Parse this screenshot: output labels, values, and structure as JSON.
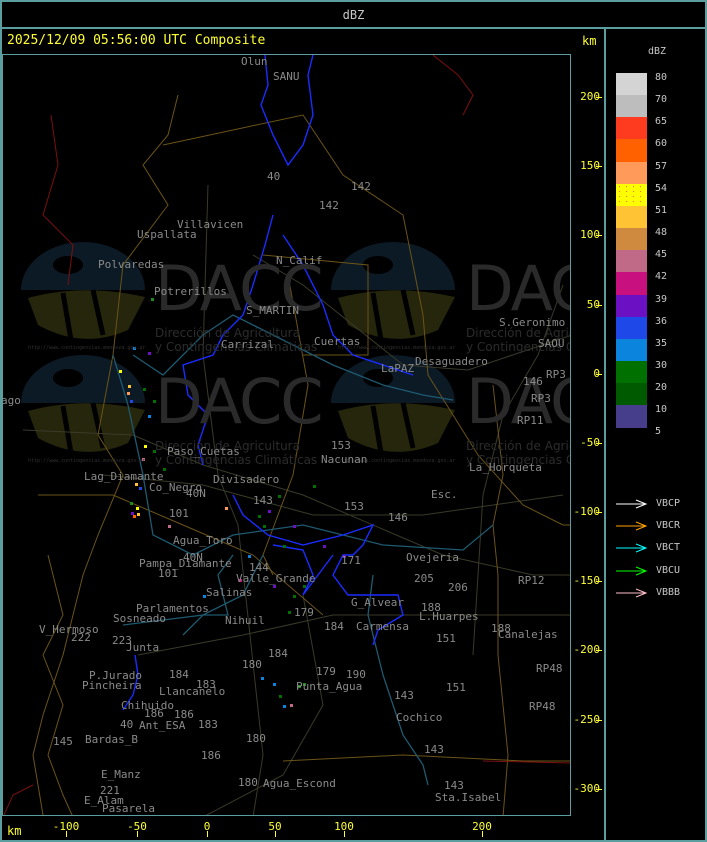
{
  "header": {
    "title": "dBZ"
  },
  "map_panel": {
    "timestamp_title": "2025/12/09 05:56:00 UTC Composite",
    "y_unit": "km",
    "x_unit": "km",
    "y_ticks": [
      "200",
      "150",
      "100",
      "50",
      "0",
      "-50",
      "-100",
      "-150",
      "-200",
      "-250",
      "-300"
    ],
    "x_ticks": [
      "-100",
      "-50",
      "0",
      "50",
      "100",
      "200"
    ],
    "places": [
      "Olun",
      "SANU",
      "40",
      "142",
      "142",
      "Villavicen",
      "Uspallata",
      "Polvaredas",
      "N_Calif",
      "Potrerillos",
      "S_MARTIN",
      "Carrizal",
      "Cuertas",
      "LaPAZ",
      "Desaguadero",
      "S.Geronimo",
      "SAOU",
      "146",
      "RP3",
      "RP3",
      "RP11",
      "153",
      "Nacunan",
      "La_Horqueta",
      "Paso_Cuetas",
      "Lag_Diamante",
      "Co_Negro",
      "Divisadero",
      "40N",
      "143",
      "101",
      "153",
      "146",
      "Esc.",
      "Agua_Toro",
      "40N",
      "Pampa_Diamante",
      "101",
      "144",
      "Valle_Grande",
      "Salinas",
      "171",
      "Ovejeria",
      "205",
      "206",
      "RP12",
      "G_Alvear",
      "179",
      "188",
      "L.Huarpes",
      "Carmensa",
      "184",
      "188",
      "Canalejas",
      "151",
      "RP48",
      "RP48",
      "Parlamentos",
      "Sosneado",
      "Nihuil",
      "V_Hermoso",
      "222",
      "223",
      "Junta",
      "P.Jurado",
      "Pincheira",
      "184",
      "Llancanelo",
      "180",
      "184",
      "183",
      "Chihuido",
      "186",
      "186",
      "40",
      "Ant_ESA",
      "183",
      "145",
      "Bardas_B",
      "180",
      "186",
      "E_Manz",
      "221",
      "E_Alam",
      "Pasarela",
      "180",
      "Agua_Escond",
      "179",
      "190",
      "Punta_Agua",
      "143",
      "151",
      "Cochico",
      "143",
      "143",
      "Sta.Isabel",
      "ago"
    ],
    "watermark": {
      "logo_text": "DACC",
      "line1": "Dirección de Agricultura",
      "line2": "y Contingencias Climáticas",
      "url": "http://www.contingencias.mendoza.gov.ar"
    }
  },
  "legend": {
    "title": "dBZ",
    "levels": [
      "80",
      "70",
      "65",
      "60",
      "57",
      "54",
      "51",
      "48",
      "45",
      "42",
      "39",
      "36",
      "35",
      "30",
      "20",
      "10",
      "5"
    ],
    "colors": [
      "#d4d4d4",
      "#bdbdbd",
      "#ff3b1f",
      "#ff6100",
      "#ff9a5a",
      "#ffff00",
      "#ffc334",
      "#d08a40",
      "#c06a88",
      "#c8107f",
      "#6c10c4",
      "#1e48e8",
      "#0a84dc",
      "#007000",
      "#005a00",
      "#463e8a"
    ],
    "arrows": [
      {
        "label": "VBCP",
        "color": "#ffffff"
      },
      {
        "label": "VBCR",
        "color": "#ffa500"
      },
      {
        "label": "VBCT",
        "color": "#00ffff"
      },
      {
        "label": "VBCU",
        "color": "#00ff00"
      },
      {
        "label": "VBBB",
        "color": "#ffc0cb"
      }
    ]
  }
}
